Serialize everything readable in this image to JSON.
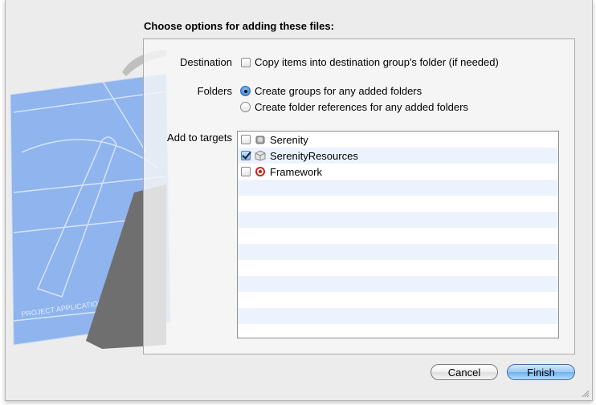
{
  "dialog": {
    "heading": "Choose options for adding these files:",
    "destination": {
      "label": "Destination",
      "option": "Copy items into destination group's folder (if needed)",
      "checked": false
    },
    "folders": {
      "label": "Folders",
      "options": [
        {
          "label": "Create groups for any added folders",
          "selected": true
        },
        {
          "label": "Create folder references for any added folders",
          "selected": false
        }
      ]
    },
    "targets": {
      "label": "Add to targets",
      "items": [
        {
          "name": "Serenity",
          "checked": false,
          "icon": "app-target-icon"
        },
        {
          "name": "SerenityResources",
          "checked": true,
          "icon": "bundle-target-icon"
        },
        {
          "name": "Framework",
          "checked": false,
          "icon": "target-bullseye-icon"
        }
      ]
    },
    "buttons": {
      "cancel": "Cancel",
      "finish": "Finish"
    }
  },
  "illustration": {
    "blueprint_text": "PROJECT APPLICATION.APP"
  },
  "colors": {
    "blueprint": "#8fb4ee",
    "accent": "#6fb0ee"
  }
}
